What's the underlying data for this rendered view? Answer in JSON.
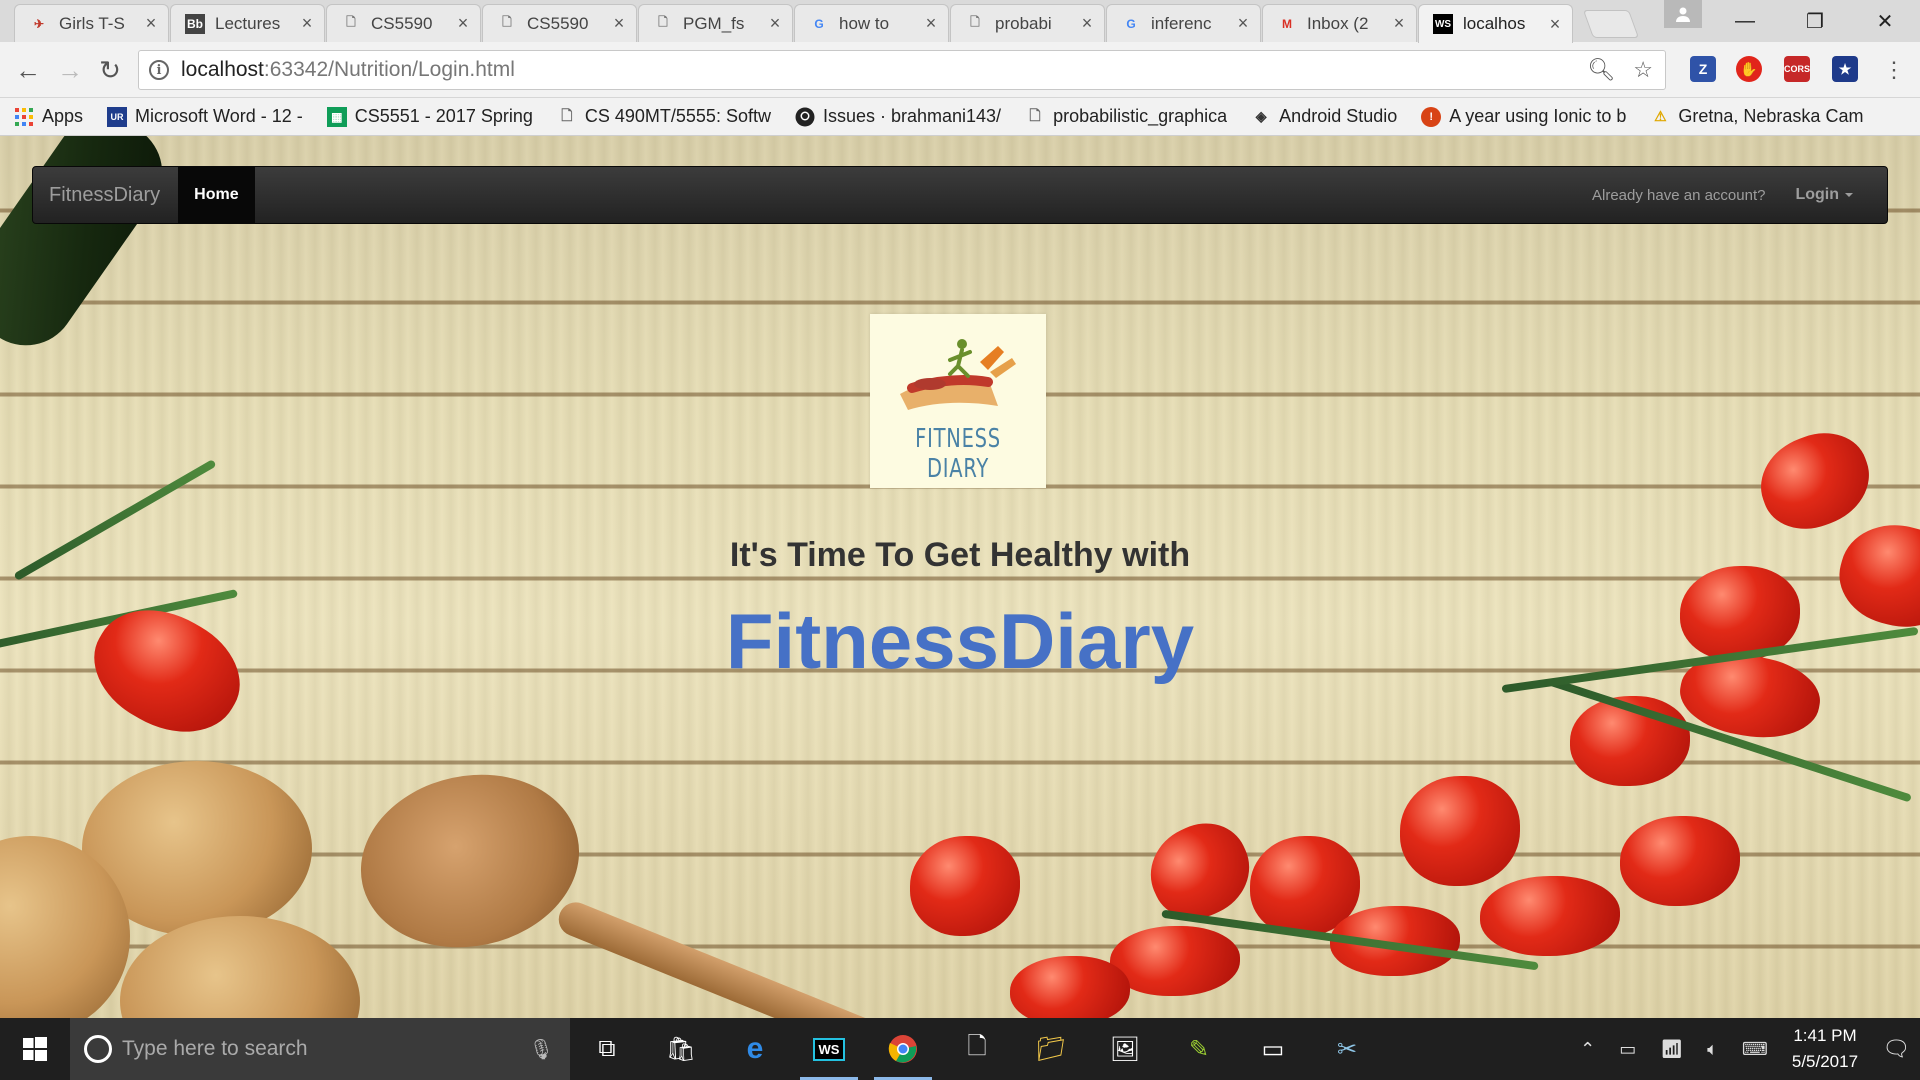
{
  "browser": {
    "tabs": [
      {
        "title": "Girls T-S",
        "icon": "site-icon",
        "color": "#c0392b"
      },
      {
        "title": "Lectures",
        "icon": "blackboard-icon",
        "color": "#444444"
      },
      {
        "title": "CS5590",
        "icon": "page-icon",
        "color": "#777777"
      },
      {
        "title": "CS5590",
        "icon": "page-icon",
        "color": "#777777"
      },
      {
        "title": "PGM_fs",
        "icon": "page-icon",
        "color": "#777777"
      },
      {
        "title": "how to",
        "icon": "google-icon",
        "color": "#4285f4"
      },
      {
        "title": "probabi",
        "icon": "page-icon",
        "color": "#777777"
      },
      {
        "title": "inferenc",
        "icon": "google-icon",
        "color": "#4285f4"
      },
      {
        "title": "Inbox (2",
        "icon": "gmail-icon",
        "color": "#d93025"
      },
      {
        "title": "localhos",
        "icon": "webstorm-icon",
        "color": "#000000"
      }
    ],
    "url_host": "localhost",
    "url_rest": ":63342/Nutrition/Login.html",
    "bookmarks": [
      {
        "label": "Apps",
        "icon": "apps-grid-icon"
      },
      {
        "label": "Microsoft Word - 12 -",
        "icon": "umkc-icon"
      },
      {
        "label": "CS5551 - 2017 Spring",
        "icon": "sheets-icon"
      },
      {
        "label": "CS 490MT/5555: Softw",
        "icon": "page-icon"
      },
      {
        "label": "Issues · brahmani143/",
        "icon": "github-icon"
      },
      {
        "label": "probabilistic_graphica",
        "icon": "page-icon"
      },
      {
        "label": "Android Studio",
        "icon": "android-studio-icon"
      },
      {
        "label": "A year using Ionic to b",
        "icon": "ionic-icon"
      },
      {
        "label": "Gretna, Nebraska Cam",
        "icon": "warning-icon"
      }
    ]
  },
  "navbar": {
    "brand": "FitnessDiary",
    "home": "Home",
    "account_prompt": "Already have an account?",
    "login": "Login"
  },
  "hero": {
    "logo_text": "FITNESS DIARY",
    "subtitle": "It's Time To Get Healthy with",
    "title": "FitnessDiary"
  },
  "taskbar": {
    "search_placeholder": "Type here to search",
    "time": "1:41 PM",
    "date": "5/5/2017"
  },
  "colors": {
    "accent_title": "#4671c6",
    "navbar_bg": "#222222"
  }
}
